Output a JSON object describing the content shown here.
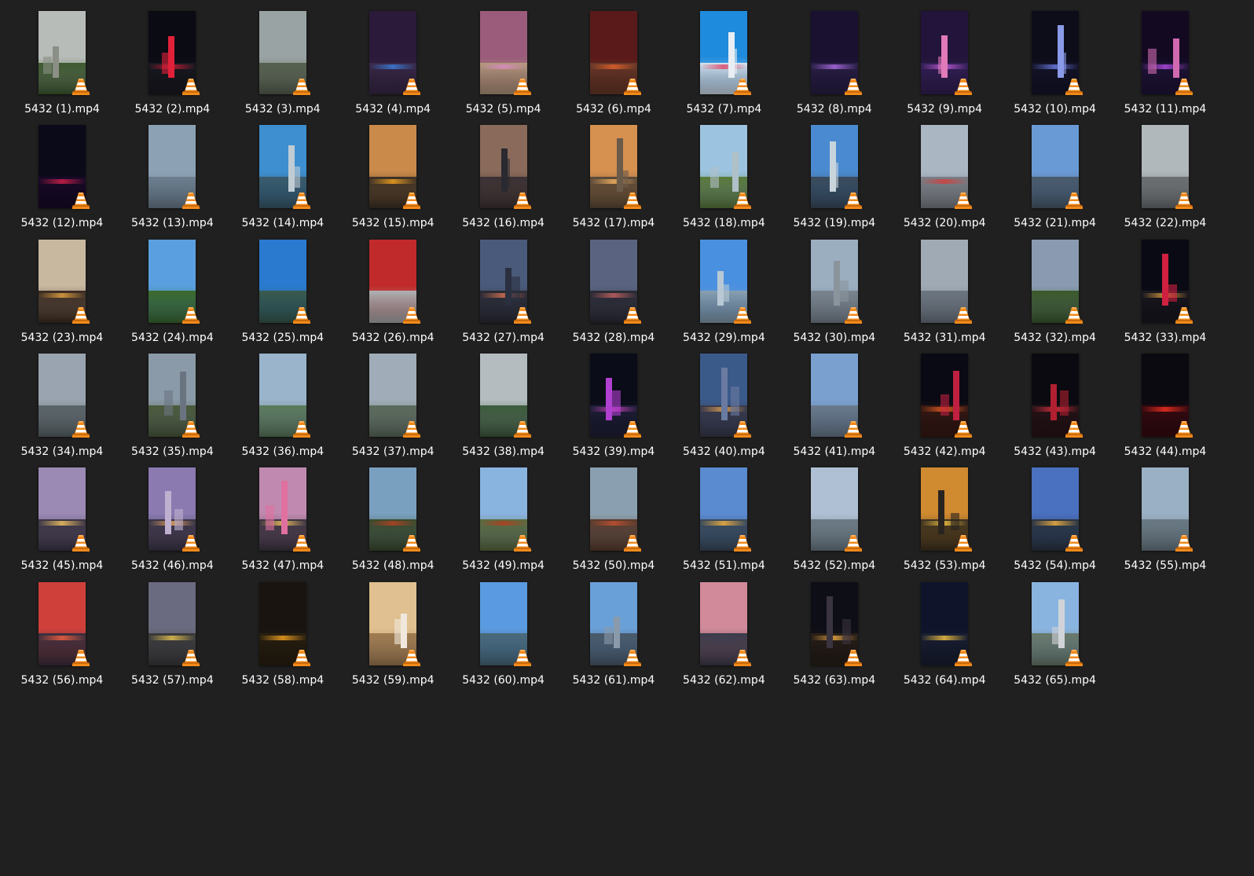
{
  "window": {
    "view": "large-icons",
    "background": "#202020",
    "text_color": "#ffffff"
  },
  "file_icon": "vlc-cone-icon",
  "accent": {
    "vlc_orange": "#f28a1a",
    "vlc_white": "#ffffff"
  },
  "files": [
    {
      "name": "5432 (1).mp4",
      "thumb": {
        "sky": "#b7bcb8",
        "ground": "#3d5a2f",
        "glow": "",
        "tower": "#8b8f86"
      }
    },
    {
      "name": "5432 (2).mp4",
      "thumb": {
        "sky": "#0b0b14",
        "ground": "#1a1a22",
        "glow": "#c21d35",
        "tower": "#e1213a"
      }
    },
    {
      "name": "5432 (3).mp4",
      "thumb": {
        "sky": "#9aa3a3",
        "ground": "#55604e",
        "glow": "",
        "tower": ""
      }
    },
    {
      "name": "5432 (4).mp4",
      "thumb": {
        "sky": "#2b1a3a",
        "ground": "#3a2a4a",
        "glow": "#3b7bd6",
        "tower": ""
      }
    },
    {
      "name": "5432 (5).mp4",
      "thumb": {
        "sky": "#9a5c7a",
        "ground": "#b59a7d",
        "glow": "#d88ac0",
        "tower": ""
      }
    },
    {
      "name": "5432 (6).mp4",
      "thumb": {
        "sky": "#5a1a1a",
        "ground": "#6a3a2a",
        "glow": "#e0612a",
        "tower": ""
      }
    },
    {
      "name": "5432 (7).mp4",
      "thumb": {
        "sky": "#1f8bdc",
        "ground": "#d9e4ee",
        "glow": "#e04a6a",
        "tower": "#e8eef3"
      }
    },
    {
      "name": "5432 (8).mp4",
      "thumb": {
        "sky": "#1a1030",
        "ground": "#2a2048",
        "glow": "#a86ae0",
        "tower": ""
      }
    },
    {
      "name": "5432 (9).mp4",
      "thumb": {
        "sky": "#22143a",
        "ground": "#342058",
        "glow": "#c25bd9",
        "tower": "#e07ab8"
      }
    },
    {
      "name": "5432 (10).mp4",
      "thumb": {
        "sky": "#0d0d1a",
        "ground": "#14142a",
        "glow": "#6a7ae0",
        "tower": "#8a9ae8"
      }
    },
    {
      "name": "5432 (11).mp4",
      "thumb": {
        "sky": "#130a22",
        "ground": "#20143a",
        "glow": "#b04ae0",
        "tower": "#d06ab0"
      }
    },
    {
      "name": "5432 (12).mp4",
      "thumb": {
        "sky": "#0a0a18",
        "ground": "#1a0a2a",
        "glow": "#d0204a",
        "tower": ""
      }
    },
    {
      "name": "5432 (13).mp4",
      "thumb": {
        "sky": "#8ca2b4",
        "ground": "#6c7f90",
        "glow": "",
        "tower": ""
      }
    },
    {
      "name": "5432 (14).mp4",
      "thumb": {
        "sky": "#3d8fd0",
        "ground": "#3a5a6a",
        "glow": "",
        "tower": "#c0ccd4"
      }
    },
    {
      "name": "5432 (15).mp4",
      "thumb": {
        "sky": "#c98a4a",
        "ground": "#3a3026",
        "glow": "#f0a020",
        "tower": ""
      }
    },
    {
      "name": "5432 (16).mp4",
      "thumb": {
        "sky": "#8a6a5a",
        "ground": "#3a3034",
        "glow": "",
        "tower": "#2a2a30"
      }
    },
    {
      "name": "5432 (17).mp4",
      "thumb": {
        "sky": "#d69050",
        "ground": "#5a4a3a",
        "glow": "#f0b060",
        "tower": "#6a5a4a"
      }
    },
    {
      "name": "5432 (18).mp4",
      "thumb": {
        "sky": "#9cc4e0",
        "ground": "#5a7a3a",
        "glow": "",
        "tower": "#b0c0c8"
      }
    },
    {
      "name": "5432 (19).mp4",
      "thumb": {
        "sky": "#4a8ad0",
        "ground": "#3a4a5a",
        "glow": "",
        "tower": "#c8d4dc"
      }
    },
    {
      "name": "5432 (20).mp4",
      "thumb": {
        "sky": "#aab6c2",
        "ground": "#7a7e84",
        "glow": "#d04040",
        "tower": ""
      }
    },
    {
      "name": "5432 (21).mp4",
      "thumb": {
        "sky": "#6a9ad6",
        "ground": "#4a5a6a",
        "glow": "",
        "tower": ""
      }
    },
    {
      "name": "5432 (22).mp4",
      "thumb": {
        "sky": "#b0b8bc",
        "ground": "#6a6e70",
        "glow": "",
        "tower": ""
      }
    },
    {
      "name": "5432 (23).mp4",
      "thumb": {
        "sky": "#c8b8a0",
        "ground": "#3a2a20",
        "glow": "#e0a040",
        "tower": ""
      }
    },
    {
      "name": "5432 (24).mp4",
      "thumb": {
        "sky": "#5aa0e0",
        "ground": "#3a6a2a",
        "glow": "",
        "tower": ""
      }
    },
    {
      "name": "5432 (25).mp4",
      "thumb": {
        "sky": "#2a7ad0",
        "ground": "#3a5a4a",
        "glow": "",
        "tower": ""
      }
    },
    {
      "name": "5432 (26).mp4",
      "thumb": {
        "sky": "#c02a2a",
        "ground": "#b0b4b8",
        "glow": "",
        "tower": ""
      }
    },
    {
      "name": "5432 (27).mp4",
      "thumb": {
        "sky": "#4a5a7a",
        "ground": "#2a2a34",
        "glow": "#d07050",
        "tower": "#2a3040"
      }
    },
    {
      "name": "5432 (28).mp4",
      "thumb": {
        "sky": "#5a6480",
        "ground": "#2a2a34",
        "glow": "#c06060",
        "tower": ""
      }
    },
    {
      "name": "5432 (29).mp4",
      "thumb": {
        "sky": "#4a90e0",
        "ground": "#8aa0b0",
        "glow": "",
        "tower": "#b8c8d4"
      }
    },
    {
      "name": "5432 (30).mp4",
      "thumb": {
        "sky": "#9aaec0",
        "ground": "#7a8490",
        "glow": "",
        "tower": "#8a949c"
      }
    },
    {
      "name": "5432 (31).mp4",
      "thumb": {
        "sky": "#a0aab4",
        "ground": "#6a7480",
        "glow": "",
        "tower": ""
      }
    },
    {
      "name": "5432 (32).mp4",
      "thumb": {
        "sky": "#8a9ab0",
        "ground": "#3a5a2a",
        "glow": "",
        "tower": ""
      }
    },
    {
      "name": "5432 (33).mp4",
      "thumb": {
        "sky": "#0a0a14",
        "ground": "#1a1820",
        "glow": "#e0a040",
        "tower": "#d02040"
      }
    },
    {
      "name": "5432 (34).mp4",
      "thumb": {
        "sky": "#9aa4b0",
        "ground": "#5a6468",
        "glow": "",
        "tower": ""
      }
    },
    {
      "name": "5432 (35).mp4",
      "thumb": {
        "sky": "#8a9aa8",
        "ground": "#4a5a3a",
        "glow": "",
        "tower": "#6a7480"
      }
    },
    {
      "name": "5432 (36).mp4",
      "thumb": {
        "sky": "#9ab4cc",
        "ground": "#5a7a5a",
        "glow": "",
        "tower": ""
      }
    },
    {
      "name": "5432 (37).mp4",
      "thumb": {
        "sky": "#a0acb8",
        "ground": "#5a6a5a",
        "glow": "",
        "tower": ""
      }
    },
    {
      "name": "5432 (38).mp4",
      "thumb": {
        "sky": "#b4bcc0",
        "ground": "#3a5a3a",
        "glow": "",
        "tower": ""
      }
    },
    {
      "name": "5432 (39).mp4",
      "thumb": {
        "sky": "#0a0c18",
        "ground": "#20203a",
        "glow": "#d040c0",
        "tower": "#b040d0"
      }
    },
    {
      "name": "5432 (40).mp4",
      "thumb": {
        "sky": "#3a5a8a",
        "ground": "#3a3a4a",
        "glow": "#e0a050",
        "tower": "#6a7aa0"
      }
    },
    {
      "name": "5432 (41).mp4",
      "thumb": {
        "sky": "#7aa0d0",
        "ground": "#6a7a8a",
        "glow": "",
        "tower": ""
      }
    },
    {
      "name": "5432 (42).mp4",
      "thumb": {
        "sky": "#0a0a14",
        "ground": "#3a1a14",
        "glow": "#f06020",
        "tower": "#c02040"
      }
    },
    {
      "name": "5432 (43).mp4",
      "thumb": {
        "sky": "#0a0a10",
        "ground": "#2a1418",
        "glow": "#e03040",
        "tower": "#b02030"
      }
    },
    {
      "name": "5432 (44).mp4",
      "thumb": {
        "sky": "#0a0a10",
        "ground": "#3a0a10",
        "glow": "#f03020",
        "tower": ""
      }
    },
    {
      "name": "5432 (45).mp4",
      "thumb": {
        "sky": "#9a8ab4",
        "ground": "#3a3444",
        "glow": "#f0c060",
        "tower": ""
      }
    },
    {
      "name": "5432 (46).mp4",
      "thumb": {
        "sky": "#8a7ab0",
        "ground": "#3a3444",
        "glow": "#e0a060",
        "tower": "#c0b0d0"
      }
    },
    {
      "name": "5432 (47).mp4",
      "thumb": {
        "sky": "#c08ab0",
        "ground": "#3a3440",
        "glow": "#f0c060",
        "tower": "#e070a0"
      }
    },
    {
      "name": "5432 (48).mp4",
      "thumb": {
        "sky": "#7aa0c0",
        "ground": "#3a4a2a",
        "glow": "#b04020",
        "tower": ""
      }
    },
    {
      "name": "5432 (49).mp4",
      "thumb": {
        "sky": "#8ab4e0",
        "ground": "#5a6a3a",
        "glow": "#b04020",
        "tower": ""
      }
    },
    {
      "name": "5432 (50).mp4",
      "thumb": {
        "sky": "#8aa0b0",
        "ground": "#5a3a2a",
        "glow": "#c05030",
        "tower": ""
      }
    },
    {
      "name": "5432 (51).mp4",
      "thumb": {
        "sky": "#5a8ad0",
        "ground": "#3a4a5a",
        "glow": "#f0b040",
        "tower": ""
      }
    },
    {
      "name": "5432 (52).mp4",
      "thumb": {
        "sky": "#b0c0d4",
        "ground": "#6a7a84",
        "glow": "",
        "tower": ""
      }
    },
    {
      "name": "5432 (53).mp4",
      "thumb": {
        "sky": "#d08a30",
        "ground": "#3a3020",
        "glow": "#f0c040",
        "tower": "#2a2420"
      }
    },
    {
      "name": "5432 (54).mp4",
      "thumb": {
        "sky": "#4a70c0",
        "ground": "#2a3440",
        "glow": "#f0b040",
        "tower": ""
      }
    },
    {
      "name": "5432 (55).mp4",
      "thumb": {
        "sky": "#9ab0c4",
        "ground": "#6a7a84",
        "glow": "",
        "tower": ""
      }
    },
    {
      "name": "5432 (56).mp4",
      "thumb": {
        "sky": "#d0403a",
        "ground": "#3a3040",
        "glow": "#f06040",
        "tower": ""
      }
    },
    {
      "name": "5432 (57).mp4",
      "thumb": {
        "sky": "#6a6a80",
        "ground": "#3a3a3a",
        "glow": "#e0c050",
        "tower": ""
      }
    },
    {
      "name": "5432 (58).mp4",
      "thumb": {
        "sky": "#1a1410",
        "ground": "#2a2010",
        "glow": "#f0a020",
        "tower": ""
      }
    },
    {
      "name": "5432 (59).mp4",
      "thumb": {
        "sky": "#e0c090",
        "ground": "#a07a50",
        "glow": "",
        "tower": "#f0e8dc"
      }
    },
    {
      "name": "5432 (60).mp4",
      "thumb": {
        "sky": "#5a9ae0",
        "ground": "#4a6a7a",
        "glow": "",
        "tower": ""
      }
    },
    {
      "name": "5432 (61).mp4",
      "thumb": {
        "sky": "#6aa0d8",
        "ground": "#4a5a6a",
        "glow": "",
        "tower": "#8a9aaa"
      }
    },
    {
      "name": "5432 (62).mp4",
      "thumb": {
        "sky": "#d08a9a",
        "ground": "#3a3a4a",
        "glow": "#404050",
        "tower": ""
      }
    },
    {
      "name": "5432 (63).mp4",
      "thumb": {
        "sky": "#0e0e16",
        "ground": "#2a2018",
        "glow": "#e0a040",
        "tower": "#3a3440"
      }
    },
    {
      "name": "5432 (64).mp4",
      "thumb": {
        "sky": "#10142a",
        "ground": "#1a2034",
        "glow": "#f0c040",
        "tower": ""
      }
    },
    {
      "name": "5432 (65).mp4",
      "thumb": {
        "sky": "#8ab4e0",
        "ground": "#6a7a6a",
        "glow": "",
        "tower": "#d0d4d8"
      }
    }
  ]
}
